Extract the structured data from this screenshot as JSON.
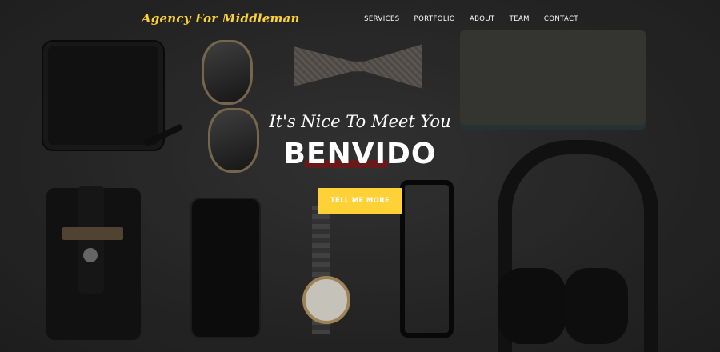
{
  "brand": "Agency For Middleman",
  "nav": {
    "items": [
      "SERVICES",
      "PORTFOLIO",
      "ABOUT",
      "TEAM",
      "CONTACT"
    ]
  },
  "hero": {
    "lead": "It's Nice To Meet You",
    "heading": "BENVIDO",
    "button_label": "TELL ME MORE"
  },
  "colors": {
    "accent": "#fed136",
    "text": "#ffffff",
    "background": "#2b2b2b"
  }
}
